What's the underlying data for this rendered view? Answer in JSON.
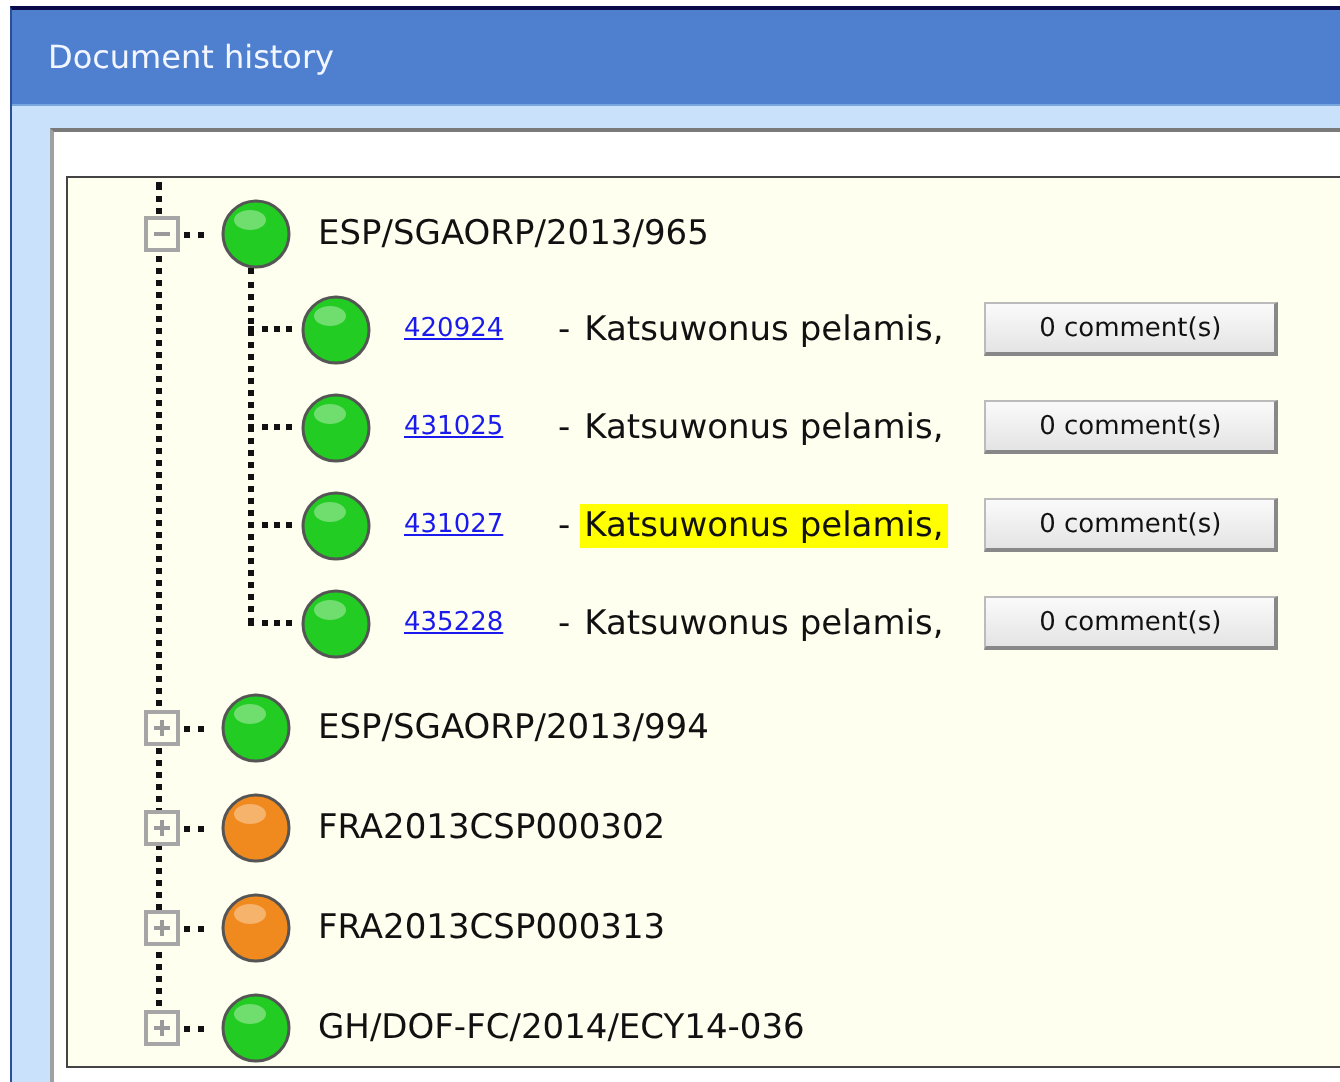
{
  "window": {
    "title": "Document history"
  },
  "tree": [
    {
      "label": "ESP/SGAORP/2013/965",
      "color": "#22cc22",
      "expanded": true,
      "children": [
        {
          "link": "420924",
          "dash": "-",
          "species": "Katsuwonus pelamis,",
          "highlighted": false,
          "button": "0 comment(s)",
          "color": "#22cc22"
        },
        {
          "link": "431025",
          "dash": "-",
          "species": "Katsuwonus pelamis,",
          "highlighted": false,
          "button": "0 comment(s)",
          "color": "#22cc22"
        },
        {
          "link": "431027",
          "dash": "-",
          "species": "Katsuwonus pelamis,",
          "highlighted": true,
          "button": "0 comment(s)",
          "color": "#22cc22"
        },
        {
          "link": "435228",
          "dash": "-",
          "species": "Katsuwonus pelamis,",
          "highlighted": false,
          "button": "0 comment(s)",
          "color": "#22cc22"
        }
      ]
    },
    {
      "label": "ESP/SGAORP/2013/994",
      "color": "#22cc22",
      "expanded": false
    },
    {
      "label": "FRA2013CSP000302",
      "color": "#f08a1e",
      "expanded": false
    },
    {
      "label": "FRA2013CSP000313",
      "color": "#f08a1e",
      "expanded": false
    },
    {
      "label": "GH/DOF-FC/2014/ECY14-036",
      "color": "#22cc22",
      "expanded": false
    }
  ]
}
